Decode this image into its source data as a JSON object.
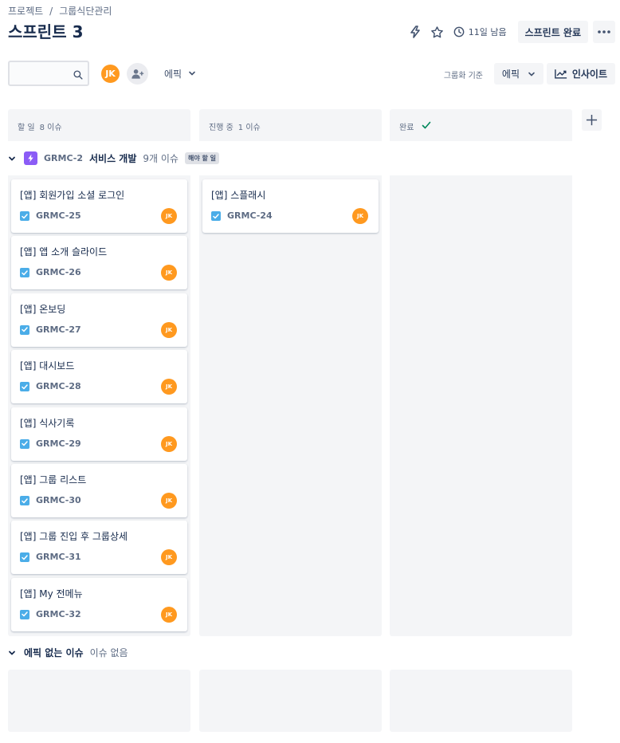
{
  "breadcrumb": {
    "project": "프로젝트",
    "separator": "/",
    "board": "그룹식단관리"
  },
  "title": "스프린트 3",
  "header": {
    "remaining": "11일 남음",
    "complete_sprint": "스프린트 완료"
  },
  "toolbar": {
    "search_value": "",
    "avatar_initials": "JK",
    "epic_filter": "에픽",
    "group_by_label": "그룹화 기준",
    "group_by_value": "에픽",
    "insights": "인사이트"
  },
  "columns": [
    {
      "name": "할 일",
      "count": "8 이슈"
    },
    {
      "name": "진행 중",
      "count": "1 이슈"
    },
    {
      "name": "완료",
      "count": ""
    }
  ],
  "swimlane": {
    "epic_key": "GRMC-2",
    "epic_name": "서비스 개발",
    "issue_count": "9개 이슈",
    "status": "해야 할 일"
  },
  "todo_cards": [
    {
      "title": "[앱] 회원가입 소셜 로그인",
      "key": "GRMC-25",
      "assignee": "JK"
    },
    {
      "title": "[앱] 앱 소개 슬라이드",
      "key": "GRMC-26",
      "assignee": "JK"
    },
    {
      "title": "[앱] 온보딩",
      "key": "GRMC-27",
      "assignee": "JK"
    },
    {
      "title": "[앱] 대시보드",
      "key": "GRMC-28",
      "assignee": "JK"
    },
    {
      "title": "[앱] 식사기록",
      "key": "GRMC-29",
      "assignee": "JK"
    },
    {
      "title": "[앱] 그룹 리스트",
      "key": "GRMC-30",
      "assignee": "JK"
    },
    {
      "title": "[앱] 그룹 진입 후 그룹상세",
      "key": "GRMC-31",
      "assignee": "JK"
    },
    {
      "title": "[앱] My 전메뉴",
      "key": "GRMC-32",
      "assignee": "JK"
    }
  ],
  "inprogress_cards": [
    {
      "title": "[앱] 스플래시",
      "key": "GRMC-24",
      "assignee": "JK"
    }
  ],
  "no_epic": {
    "label": "에픽 없는 이슈",
    "count": "이슈 없음"
  },
  "colors": {
    "accent": "#0052cc",
    "avatar": "#ff991f",
    "epic": "#8b5cf6",
    "story_check": "#4bade8",
    "done_check": "#00875a"
  }
}
